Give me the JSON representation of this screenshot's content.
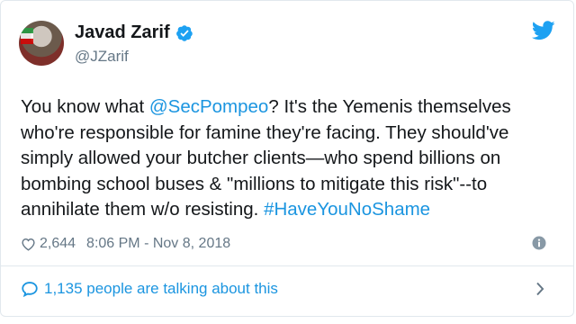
{
  "tweet": {
    "author_name": "Javad Zarif",
    "handle": "@JZarif",
    "text_lines": [
      {
        "pre": "You know what ",
        "link": "@SecPompeo",
        "post": "? It's the Yemenis themselves"
      },
      {
        "pre": "who're responsible for famine they're facing. They should've",
        "link": "",
        "post": ""
      },
      {
        "pre": "simply allowed your butcher clients—who spend billions on",
        "link": "",
        "post": ""
      },
      {
        "pre": "bombing school buses & \"millions to mitigate this risk\"--to",
        "link": "",
        "post": ""
      },
      {
        "pre": "annihilate them w/o resisting. ",
        "link": "#HaveYouNoShame",
        "post": ""
      }
    ],
    "likes": "2,644",
    "timestamp": "8:06 PM - Nov 8, 2018",
    "conversation_text": "1,135 people are talking about this"
  },
  "icons": {
    "avatar": "profile-photo",
    "verified": "verified-badge-icon",
    "brand": "twitter-bird-icon",
    "like": "heart-icon",
    "info": "info-icon",
    "conversation": "speech-bubble-icon",
    "chevron": "chevron-right-icon"
  },
  "colors": {
    "link": "#1b95e0",
    "secondary_text": "#657786",
    "primary_text": "#14171a",
    "border": "#e1e8ed"
  }
}
